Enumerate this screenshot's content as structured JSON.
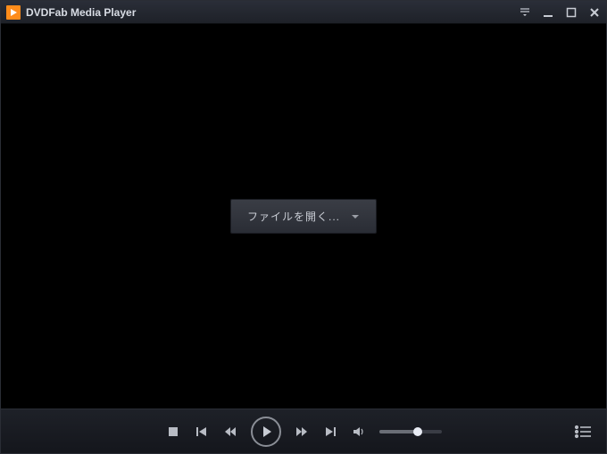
{
  "titlebar": {
    "appTitle": "DVDFab Media Player"
  },
  "main": {
    "openFileLabel": "ファイルを開く..."
  },
  "controls": {
    "volumePercent": 62
  },
  "icons": {
    "app": "play-triangle",
    "settingsMenu": "hamburger-down",
    "minimize": "minimize",
    "maximize": "maximize",
    "close": "close",
    "stop": "stop",
    "prev": "skip-previous",
    "rewind": "rewind",
    "play": "play",
    "forward": "fast-forward",
    "next": "skip-next",
    "volume": "volume",
    "playlist": "playlist"
  }
}
